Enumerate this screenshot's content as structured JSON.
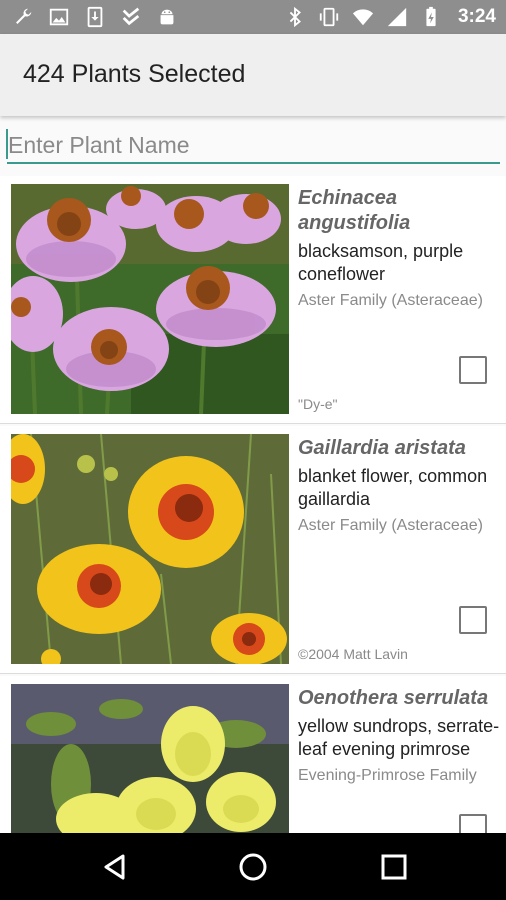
{
  "status_bar": {
    "left_icons": [
      "wrench-icon",
      "image-icon",
      "download-icon",
      "check-icon",
      "android-icon"
    ],
    "right_icons": [
      "bluetooth-icon",
      "vibrate-icon",
      "wifi-icon",
      "signal-icon",
      "battery-icon"
    ],
    "time": "3:24"
  },
  "app_bar": {
    "title": "424 Plants Selected"
  },
  "search": {
    "placeholder": "Enter Plant Name",
    "value": ""
  },
  "plants": [
    {
      "scientific_name": "Echinacea angustifolia",
      "common_name": "blacksamson, purple coneflower",
      "family": "Aster Family (Asteraceae)",
      "credit": "\"Dy-e\"",
      "selected": false
    },
    {
      "scientific_name": "Gaillardia aristata",
      "common_name": "blanket flower, common gaillardia",
      "family": "Aster Family (Asteraceae)",
      "credit": "©2004 Matt Lavin",
      "selected": false
    },
    {
      "scientific_name": "Oenothera serrulata",
      "common_name": " yellow sundrops, serrate-leaf evening primrose",
      "family": "Evening-Primrose Family",
      "credit": "",
      "selected": false
    }
  ],
  "nav_bar": {
    "buttons": [
      "back-icon",
      "home-icon",
      "recents-icon"
    ]
  },
  "colors": {
    "accent": "#3a9a8e",
    "status_bar": "#8e8e8e",
    "app_bar": "#efefef",
    "nav_bar": "#000000"
  }
}
